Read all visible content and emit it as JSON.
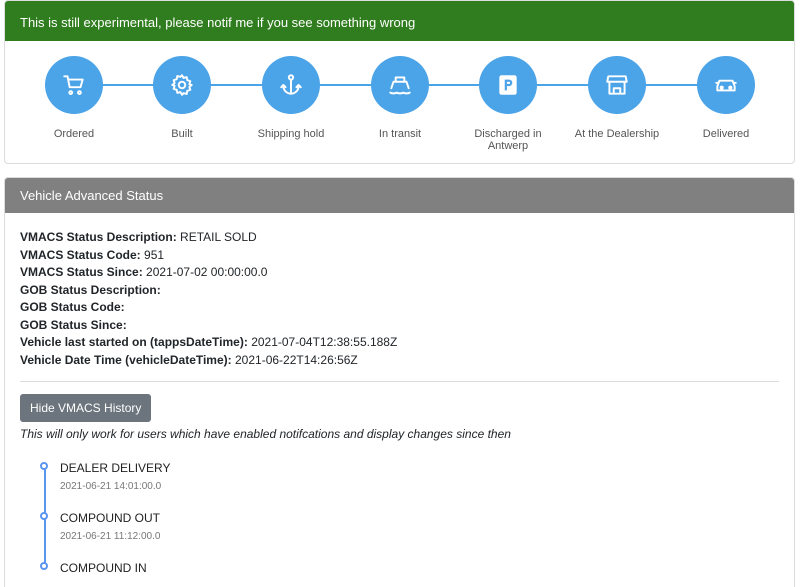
{
  "alert": "This is still experimental, please notif me if you see something wrong",
  "steps": [
    {
      "label": "Ordered",
      "icon": "cart-icon"
    },
    {
      "label": "Built",
      "icon": "gear-icon"
    },
    {
      "label": "Shipping hold",
      "icon": "anchor-icon"
    },
    {
      "label": "In transit",
      "icon": "ship-icon"
    },
    {
      "label": "Discharged in Antwerp",
      "icon": "parking-icon"
    },
    {
      "label": "At the Dealership",
      "icon": "store-icon"
    },
    {
      "label": "Delivered",
      "icon": "car-icon"
    }
  ],
  "status": {
    "title": "Vehicle Advanced Status",
    "fields": [
      {
        "k": "VMACS Status Description:",
        "v": "RETAIL SOLD"
      },
      {
        "k": "VMACS Status Code:",
        "v": "951"
      },
      {
        "k": "VMACS Status Since:",
        "v": "2021-07-02 00:00:00.0"
      },
      {
        "k": "GOB Status Description:",
        "v": ""
      },
      {
        "k": "GOB Status Code:",
        "v": ""
      },
      {
        "k": "GOB Status Since:",
        "v": ""
      },
      {
        "k": "Vehicle last started on (tappsDateTime):",
        "v": "2021-07-04T12:38:55.188Z"
      },
      {
        "k": "Vehicle Date Time (vehicleDateTime):",
        "v": "2021-06-22T14:26:56Z"
      }
    ],
    "button": "Hide VMACS History",
    "note": "This will only work for users which have enabled notifcations and display changes since then",
    "history": [
      {
        "event": "DEALER DELIVERY",
        "date": "2021-06-21 14:01:00.0"
      },
      {
        "event": "COMPOUND OUT",
        "date": "2021-06-21 11:12:00.0"
      },
      {
        "event": "COMPOUND IN",
        "date": ""
      }
    ]
  }
}
